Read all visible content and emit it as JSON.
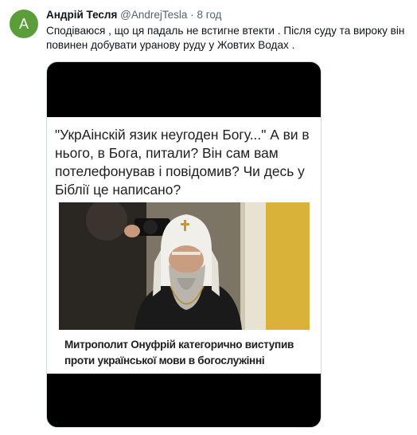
{
  "tweet": {
    "avatar_letter": "A",
    "author_name": "Андрій Тесля",
    "author_handle": "@AndrejTesla",
    "separator": "·",
    "time": "8 год",
    "text": "Сподіваюся , що ця падаль не встигне втекти . Після суду та вироку він повинен добувати уранову руду у Жовтих Водах ."
  },
  "media": {
    "quote": "\"УкрАінскій язик неугоден Богу...\" А ви в нього, в Бога, питали? Він сам вам потелефонував і повідомив? Чи десь у Біблії це написано?",
    "caption": "Митрополит Онуфрій категорично виступив проти української мови в богослужінні"
  }
}
